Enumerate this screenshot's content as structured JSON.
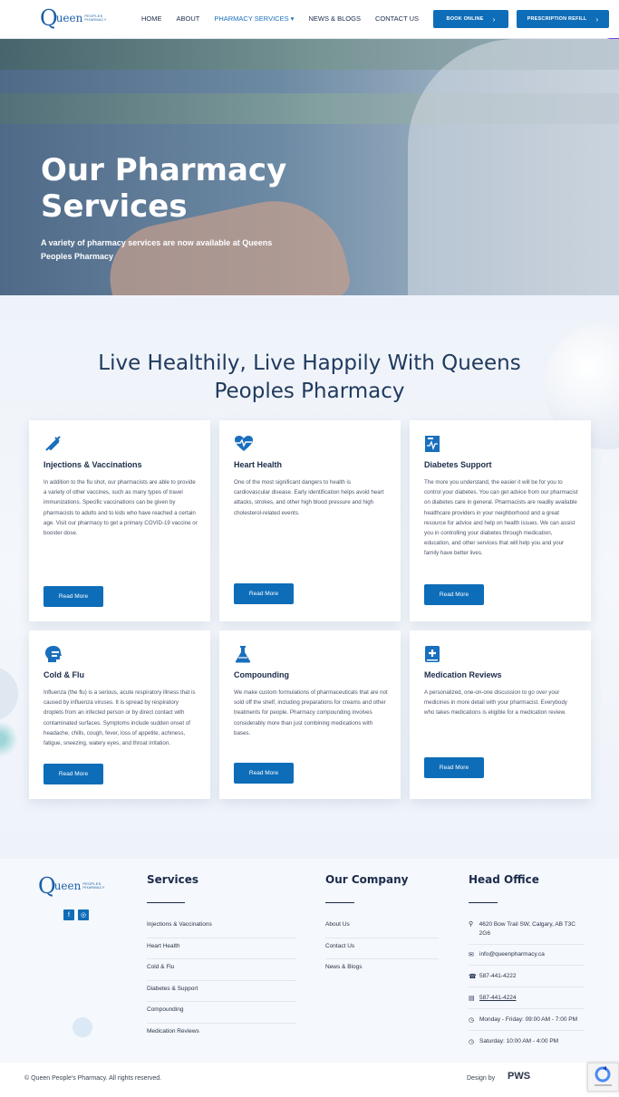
{
  "header": {
    "logo": {
      "letter": "Q",
      "text": "ueen",
      "sub": "PEOPLES PHARMACY"
    },
    "nav": [
      {
        "label": "HOME"
      },
      {
        "label": "ABOUT"
      },
      {
        "label": "PHARMACY SERVICES ▾"
      },
      {
        "label": "NEWS & BLOGS"
      },
      {
        "label": "CONTACT US"
      }
    ],
    "book_label": "BOOK ONLINE",
    "refill_label": "PRESCRIPTION REFILL",
    "accent": "#0e6db8"
  },
  "hero": {
    "title": "Our Pharmacy Services",
    "subtitle": "A variety of pharmacy services are now available at Queens Peoples Pharmacy"
  },
  "services": {
    "title": "Live Healthily, Live Happily With Queens Peoples Pharmacy",
    "read_more": "Read More",
    "cards": [
      {
        "icon": "syringe-icon",
        "title": "Injections & Vaccinations",
        "text": "In addition to the flu shot, our pharmacists are able to provide a variety of other vaccines, such as many types of travel immunizations. Specific vaccinations can be given by pharmacists to adults and to kids who have reached a certain age. Visit our pharmacy to get a primary COVID-19 vaccine or booster dose."
      },
      {
        "icon": "heartbeat-icon",
        "title": "Heart Health",
        "text": "One of the most significant dangers to health is cardiovascular disease. Early identification helps avoid heart attacks, strokes, and other high blood pressure and high cholesterol-related events."
      },
      {
        "icon": "chart-file-icon",
        "title": "Diabetes Support",
        "text": "The more you understand, the easier it will be for you to control your diabetes. You can get advice from our pharmacist on diabetes care in general. Pharmacists are readily available healthcare providers in your neighborhood and a great resource for advice and help on health issues. We can assist you in controlling your diabetes through medication, education, and other services that will help you and your family have better lives."
      },
      {
        "icon": "head-cold-icon",
        "title": "Cold & Flu",
        "text": "Influenza (the flu) is a serious, acute respiratory illness that is caused by influenza viruses. It is spread by respiratory droplets from an infected person or by direct contact with contaminated surfaces. Symptoms include sudden onset of headache, chills, cough, fever, loss of appetite, achiness, fatigue, sneezing, watery eyes, and throat irritation."
      },
      {
        "icon": "flask-icon",
        "title": "Compounding",
        "text": "We make custom formulations of pharmaceuticals that are not sold off the shelf, including preparations for creams and other treatments for people. Pharmacy compounding involves considerably more than just combining medications with bases."
      },
      {
        "icon": "medical-book-icon",
        "title": "Medication Reviews",
        "text": "A personalized, one-on-one discussion to go over your medicines in more detail with your pharmacist. Everybody who takes medications is eligible for a medication review."
      }
    ]
  },
  "footer": {
    "services_title": "Services",
    "services": [
      "Injections & Vaccinations",
      "Heart Health",
      "Cold & Flu",
      "Diabetes & Support",
      "Compounding",
      "Medication Reviews"
    ],
    "company_title": "Our Company",
    "company": [
      "About Us",
      "Contact Us",
      "News & Blogs"
    ],
    "office_title": "Head Office",
    "address": "4620 Bow Trail SW, Calgary, AB T3C 2G6",
    "email": "info@queenpharmacy.ca",
    "phone": "587-441-4222",
    "fax": "587-441-4224",
    "hours_week": "Monday - Friday: 09:00 AM - 7:00 PM",
    "hours_sat": "Saturday: 10:00 AM - 4:00 PM",
    "copyright": "© Queen People's Pharmacy. All rights reserved.",
    "design_by": "Design by",
    "designer": "PWS"
  }
}
